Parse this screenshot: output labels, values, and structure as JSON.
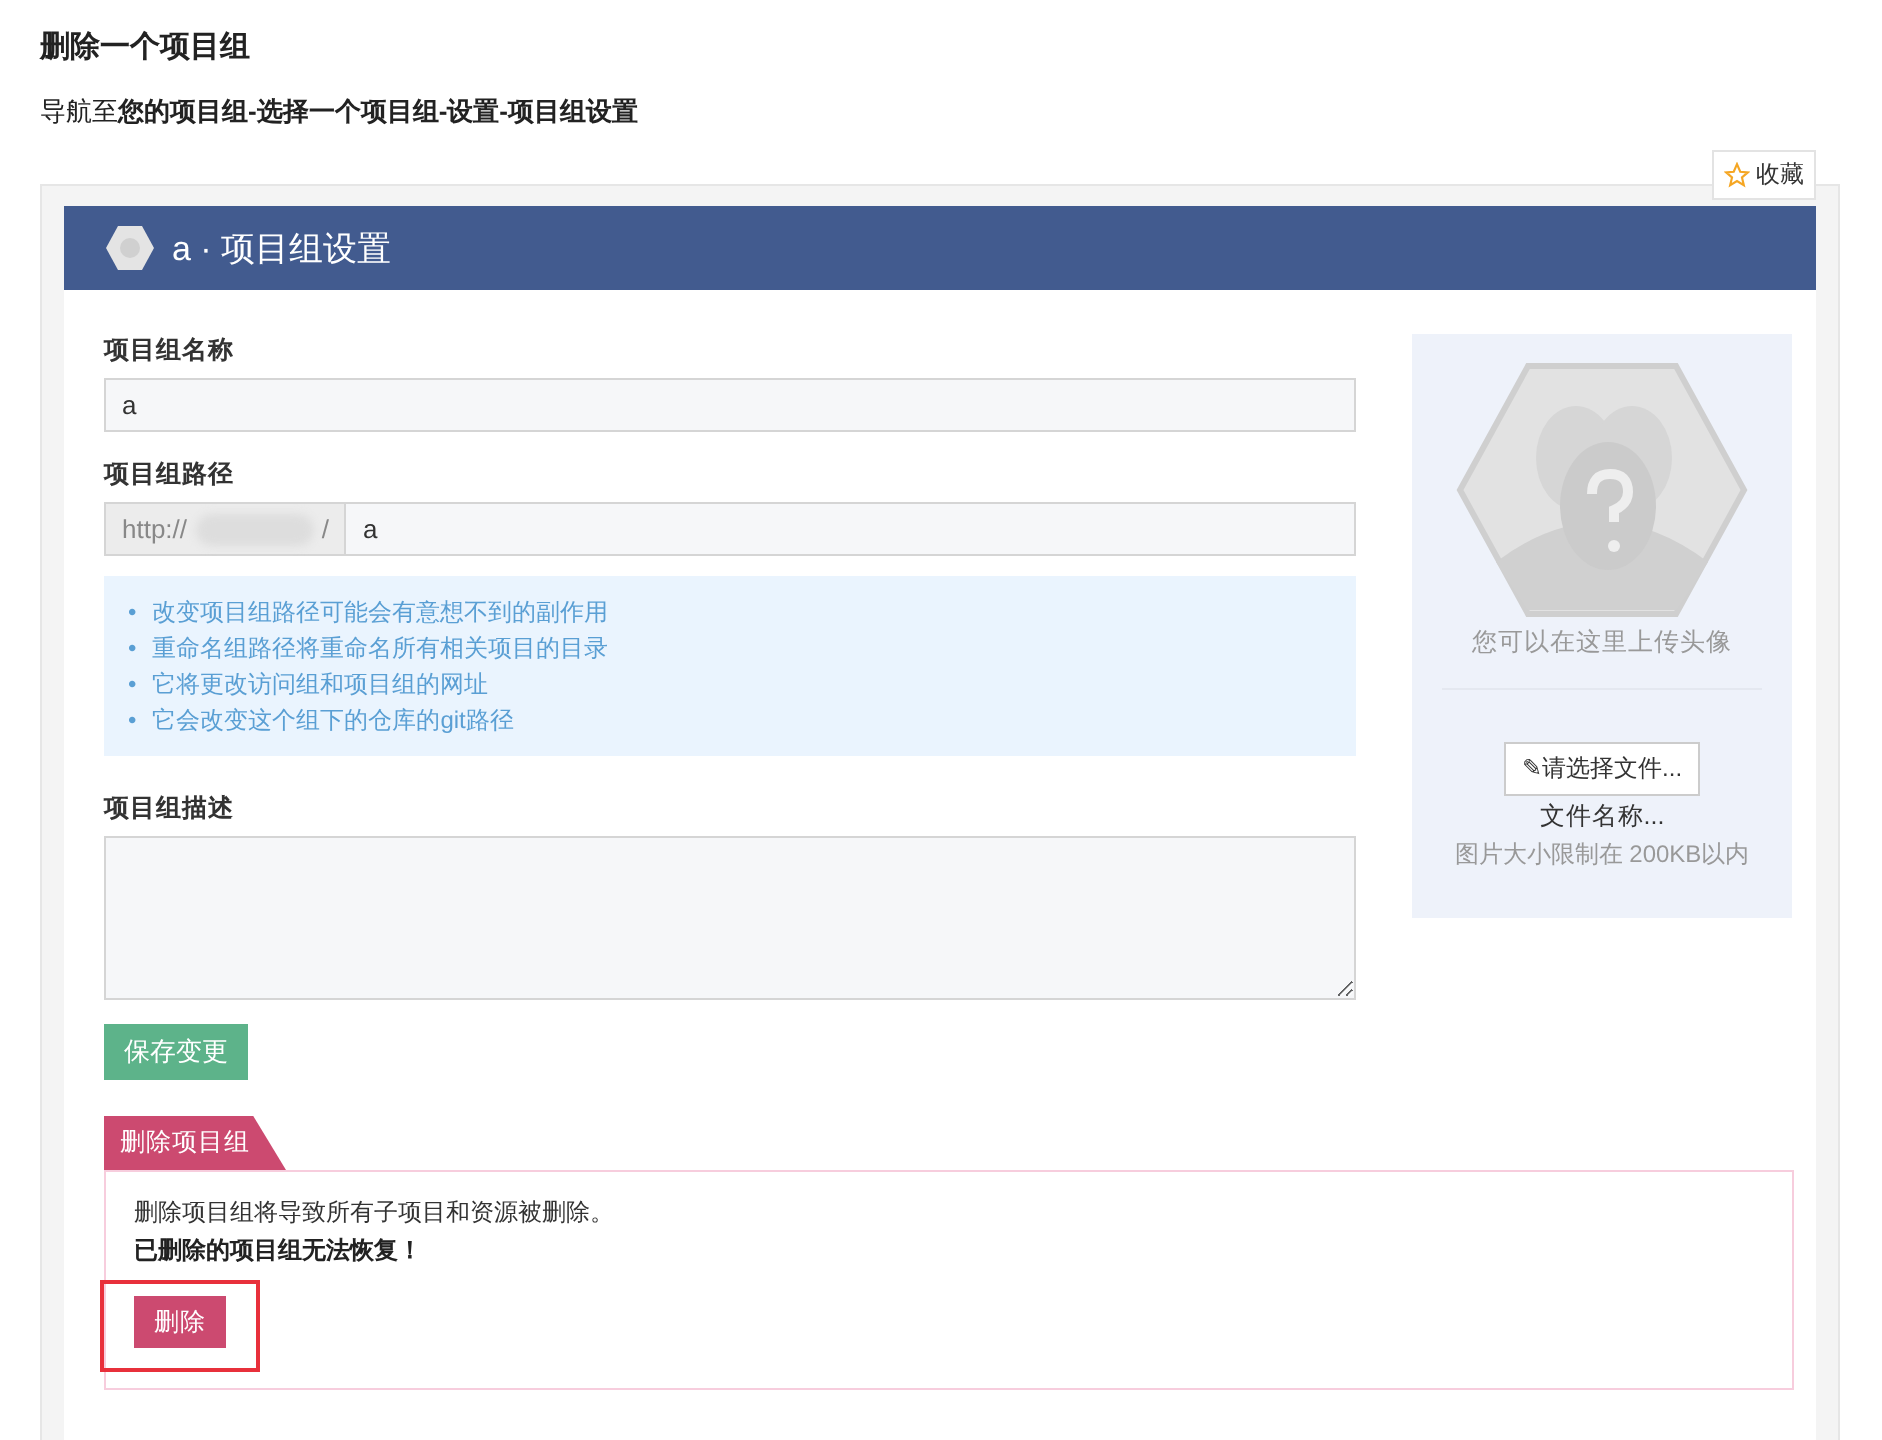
{
  "page_title": "删除一个项目组",
  "navigation": "导航至**您的项目组-选择一个项目组-设置-项目组设置**",
  "favorite_button": {
    "label": "收藏"
  },
  "panel": {
    "title": "a · 项目组设置"
  },
  "name_field": {
    "label": "项目组名称",
    "value": "a"
  },
  "path_field": {
    "label": "项目组路径",
    "prefix": "http://",
    "prefix_end": "/",
    "value": "a"
  },
  "note_marker": "•",
  "notes": [
    "改变项目组路径可能会有意想不到的副作用",
    "重命名组路径将重命名所有相关项目的目录",
    "它将更改访问组和项目组的网址",
    "它会改变这个组下的仓库的git路径"
  ],
  "description_field": {
    "label": "项目组描述"
  },
  "save_button": "保存变更",
  "avatar": {
    "hint": "您可以在这里上传头像",
    "choose_button": "✎请选择文件...",
    "file_name": "文件名称...",
    "size_limit": "图片大小限制在 200KB以内"
  },
  "delete_section": {
    "tab": "删除项目组",
    "message": "删除项目组将导致所有子项目和资源被删除。",
    "warning": "已删除的项目组无法恢复！",
    "button": "删除",
    "highlighted": true
  }
}
